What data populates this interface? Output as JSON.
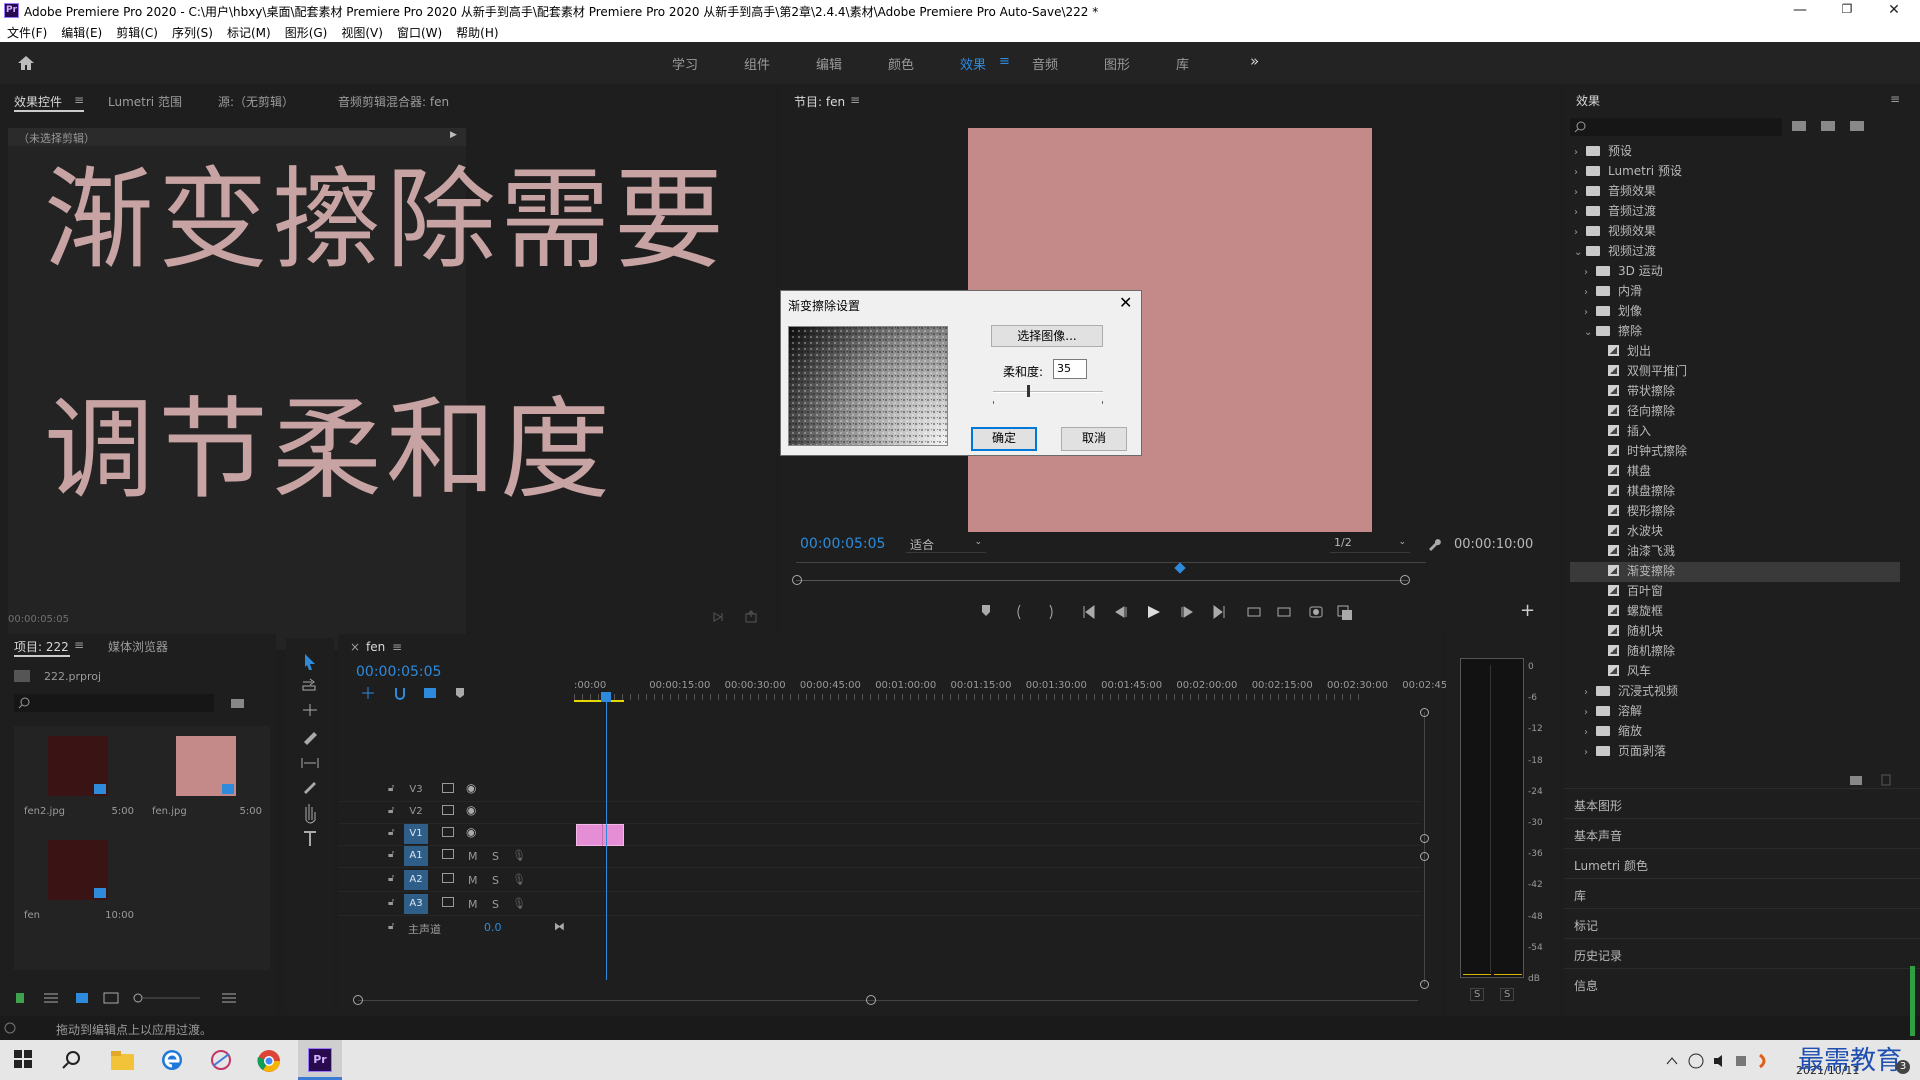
{
  "window": {
    "title": "Adobe Premiere Pro 2020 - C:\\用户\\hbxy\\桌面\\配套素材 Premiere Pro 2020 从新手到高手\\配套素材 Premiere Pro 2020 从新手到高手\\第2章\\2.4.4\\素材\\Adobe Premiere Pro Auto-Save\\222 *",
    "logo": "Pr",
    "minimize": "—",
    "maximize": "❐",
    "close": "✕"
  },
  "menu": [
    "文件(F)",
    "编辑(E)",
    "剪辑(C)",
    "序列(S)",
    "标记(M)",
    "图形(G)",
    "视图(V)",
    "窗口(W)",
    "帮助(H)"
  ],
  "workspaces": {
    "items": [
      "学习",
      "组件",
      "编辑",
      "颜色",
      "效果",
      "音频",
      "图形",
      "库"
    ],
    "active": "效果",
    "more": "»"
  },
  "source_panel": {
    "tabs": [
      "效果控件",
      "Lumetri 范围",
      "源:（无剪辑）",
      "音频剪辑混合器: fen"
    ],
    "no_clip": "（未选择剪辑）",
    "timecode": "00:00:05:05",
    "overlay_line1": "渐变擦除需要",
    "overlay_line2": "调节柔和度"
  },
  "program_panel": {
    "tab": "节目: fen",
    "timecode": "00:00:05:05",
    "fit": "适合",
    "resolution": "1/2",
    "duration": "00:00:10:00",
    "frame_color": "#c48a8a"
  },
  "dialog": {
    "title": "渐变擦除设置",
    "select_image": "选择图像...",
    "softness_label": "柔和度:",
    "softness_value": "35",
    "ok": "确定",
    "cancel": "取消"
  },
  "effects_panel": {
    "title": "效果",
    "tree": [
      {
        "label": "预设",
        "level": 0,
        "kind": "folder-star",
        "expanded": false
      },
      {
        "label": "Lumetri 预设",
        "level": 0,
        "kind": "folder-star",
        "expanded": false
      },
      {
        "label": "音频效果",
        "level": 0,
        "kind": "folder",
        "expanded": false
      },
      {
        "label": "音频过渡",
        "level": 0,
        "kind": "folder",
        "expanded": false
      },
      {
        "label": "视频效果",
        "level": 0,
        "kind": "folder",
        "expanded": false
      },
      {
        "label": "视频过渡",
        "level": 0,
        "kind": "folder",
        "expanded": true
      },
      {
        "label": "3D 运动",
        "level": 1,
        "kind": "folder",
        "expanded": false
      },
      {
        "label": "内滑",
        "level": 1,
        "kind": "folder",
        "expanded": false
      },
      {
        "label": "划像",
        "level": 1,
        "kind": "folder",
        "expanded": false
      },
      {
        "label": "擦除",
        "level": 1,
        "kind": "folder",
        "expanded": true
      },
      {
        "label": "划出",
        "level": 2,
        "kind": "fx"
      },
      {
        "label": "双侧平推门",
        "level": 2,
        "kind": "fx"
      },
      {
        "label": "带状擦除",
        "level": 2,
        "kind": "fx"
      },
      {
        "label": "径向擦除",
        "level": 2,
        "kind": "fx"
      },
      {
        "label": "插入",
        "level": 2,
        "kind": "fx"
      },
      {
        "label": "时钟式擦除",
        "level": 2,
        "kind": "fx"
      },
      {
        "label": "棋盘",
        "level": 2,
        "kind": "fx"
      },
      {
        "label": "棋盘擦除",
        "level": 2,
        "kind": "fx"
      },
      {
        "label": "楔形擦除",
        "level": 2,
        "kind": "fx"
      },
      {
        "label": "水波块",
        "level": 2,
        "kind": "fx"
      },
      {
        "label": "油漆飞溅",
        "level": 2,
        "kind": "fx"
      },
      {
        "label": "渐变擦除",
        "level": 2,
        "kind": "fx",
        "selected": true
      },
      {
        "label": "百叶窗",
        "level": 2,
        "kind": "fx"
      },
      {
        "label": "螺旋框",
        "level": 2,
        "kind": "fx"
      },
      {
        "label": "随机块",
        "level": 2,
        "kind": "fx"
      },
      {
        "label": "随机擦除",
        "level": 2,
        "kind": "fx"
      },
      {
        "label": "风车",
        "level": 2,
        "kind": "fx"
      },
      {
        "label": "沉浸式视频",
        "level": 1,
        "kind": "folder",
        "expanded": false
      },
      {
        "label": "溶解",
        "level": 1,
        "kind": "folder",
        "expanded": false
      },
      {
        "label": "缩放",
        "level": 1,
        "kind": "folder",
        "expanded": false
      },
      {
        "label": "页面剥落",
        "level": 1,
        "kind": "folder",
        "expanded": false
      }
    ],
    "sections": [
      "基本图形",
      "基本声音",
      "Lumetri 颜色",
      "库",
      "标记",
      "历史记录",
      "信息"
    ]
  },
  "project_panel": {
    "tabs": [
      "项目: 222",
      "媒体浏览器"
    ],
    "project_file": "222.prproj",
    "items": [
      {
        "name": "fen2.jpg",
        "duration": "5:00",
        "color": "#3a1414"
      },
      {
        "name": "fen.jpg",
        "duration": "5:00",
        "color": "#c48a8a"
      },
      {
        "name": "fen",
        "duration": "10:00",
        "color": "#3a1414"
      }
    ]
  },
  "timeline": {
    "tab": "fen",
    "close": "×",
    "timecode": "00:00:05:05",
    "ruler": [
      ":00:00",
      "00:00:15:00",
      "00:00:30:00",
      "00:00:45:00",
      "00:01:00:00",
      "00:01:15:00",
      "00:01:30:00",
      "00:01:45:00",
      "00:02:00:00",
      "00:02:15:00",
      "00:02:30:00",
      "00:02:45:"
    ],
    "tracks": [
      {
        "name": "V3",
        "type": "video",
        "targeted": false
      },
      {
        "name": "V2",
        "type": "video",
        "targeted": false
      },
      {
        "name": "V1",
        "type": "video",
        "targeted": true
      },
      {
        "name": "A1",
        "type": "audio",
        "targeted": true
      },
      {
        "name": "A2",
        "type": "audio",
        "targeted": true
      },
      {
        "name": "A3",
        "type": "audio",
        "targeted": true
      }
    ],
    "master_label": "主声道",
    "master_value": "0.0",
    "audio_m": "M",
    "audio_s": "S",
    "clip_color": "#e58ed6"
  },
  "meter": {
    "scale": [
      "0",
      "-6",
      "-12",
      "-18",
      "-24",
      "-30",
      "-36",
      "-42",
      "-48",
      "-54",
      "dB"
    ],
    "solo_left": "S",
    "solo_right": "S"
  },
  "status": {
    "text": "拖动到编辑点上以应用过渡。"
  },
  "taskbar": {
    "date": "2021/10/11",
    "watermark": "最需教育",
    "notif_count": "3"
  }
}
